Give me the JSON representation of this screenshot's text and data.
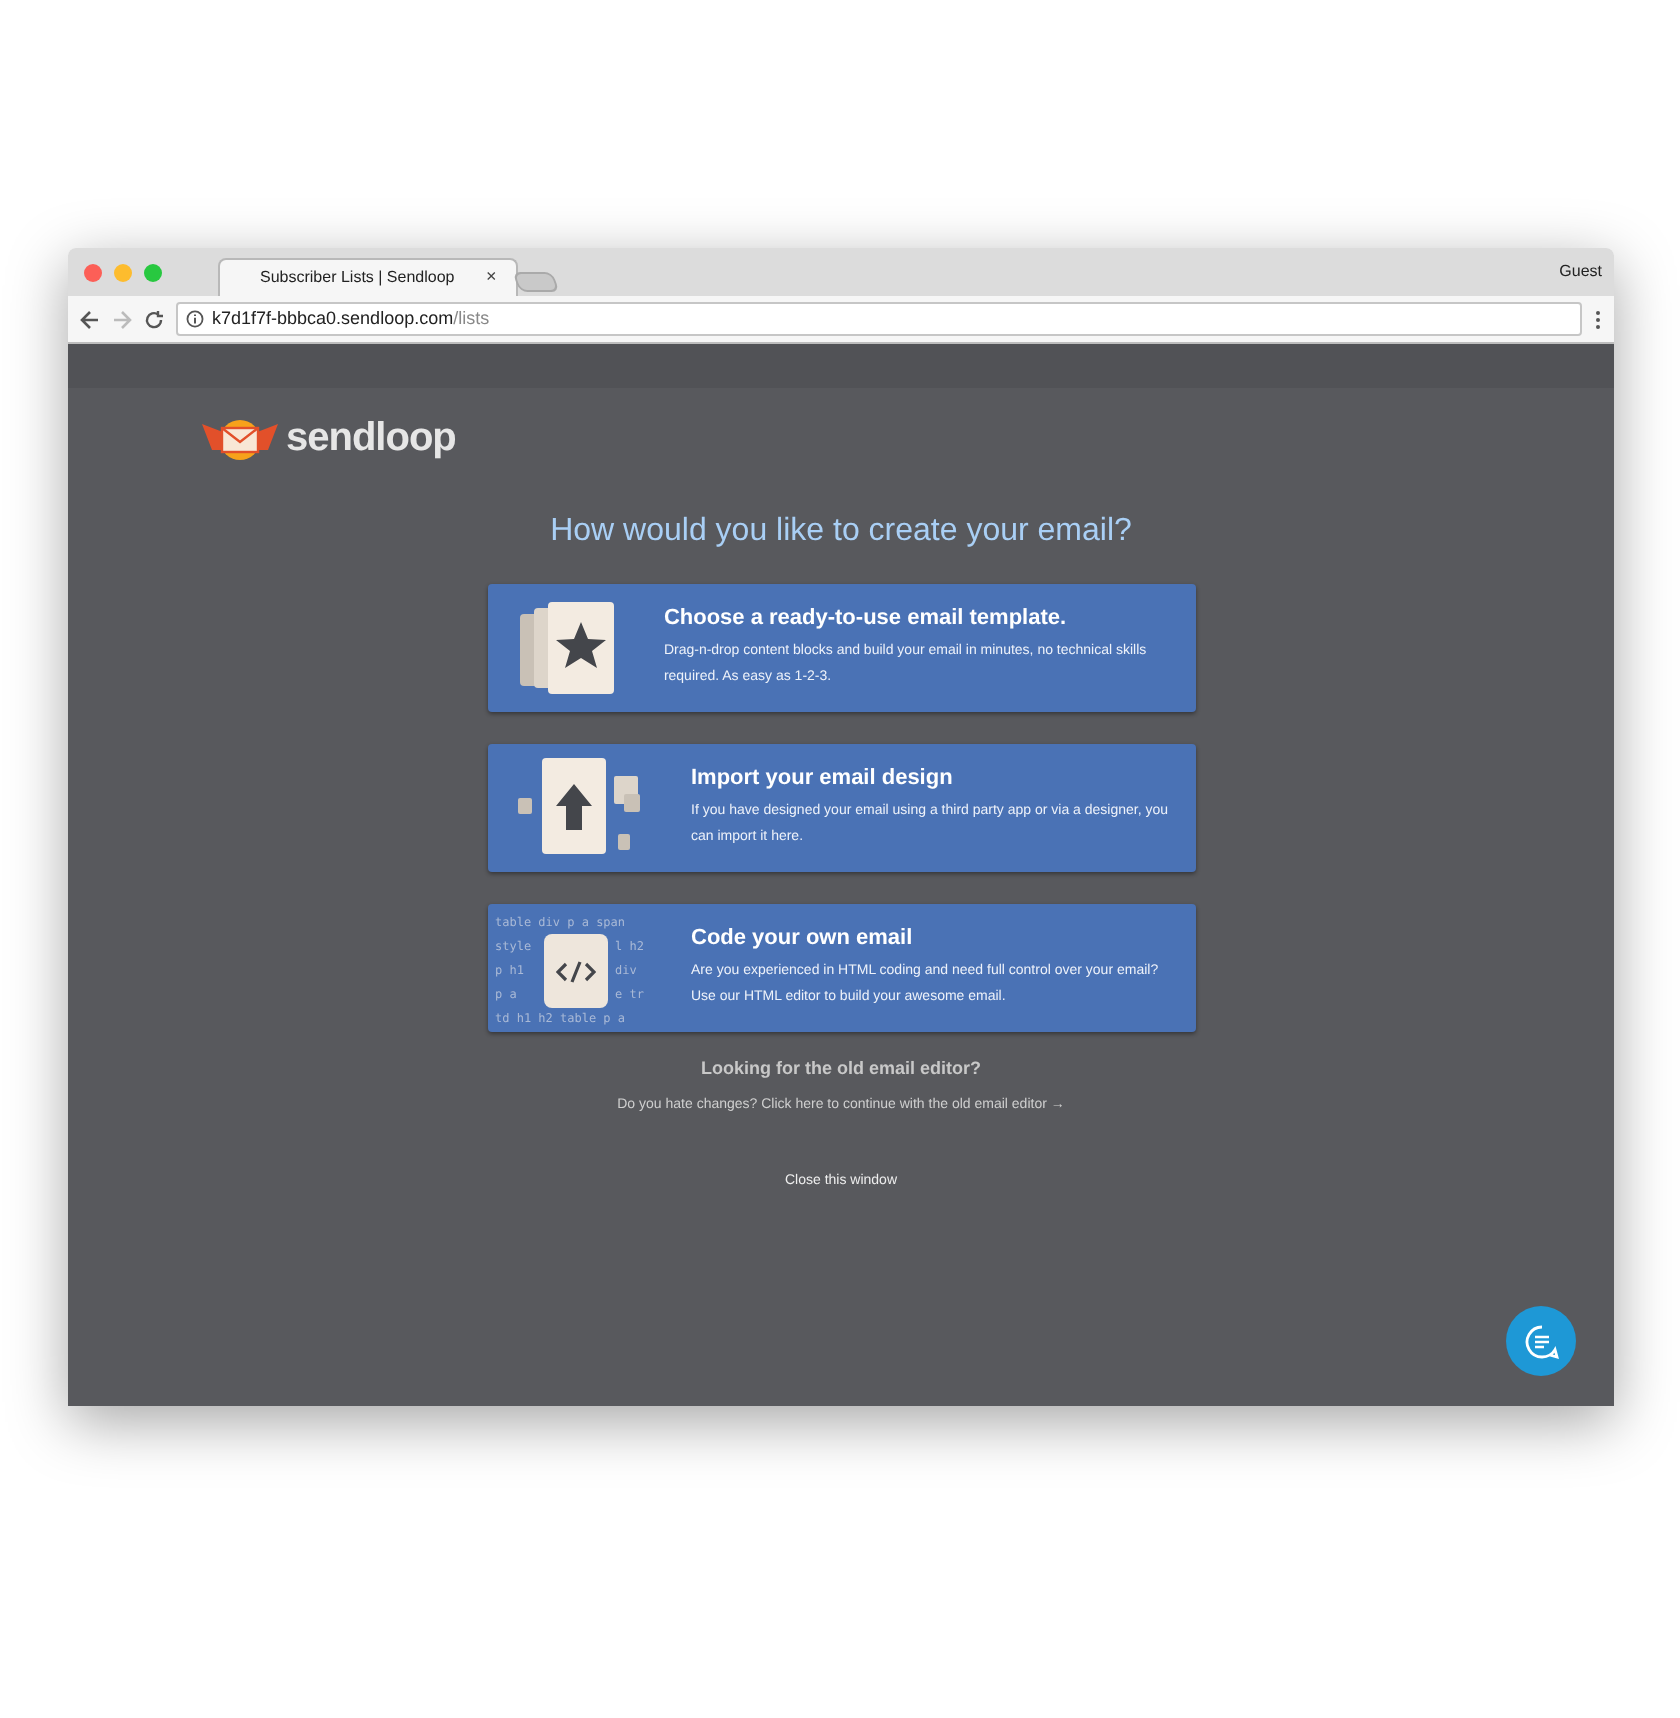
{
  "browser": {
    "tab_title": "Subscriber Lists | Sendloop",
    "tab_close": "×",
    "profile": "Guest",
    "url_host": "k7d1f7f-bbbca0.sendloop.com",
    "url_path": "/lists"
  },
  "brand": {
    "name": "sendloop"
  },
  "heading": "How would you like to create your email?",
  "options": [
    {
      "kind": "template",
      "title": "Choose a ready-to-use email template.",
      "description": "Drag-n-drop content blocks and build your email in minutes, no technical skills required. As easy as 1-2-3."
    },
    {
      "kind": "import",
      "title": "Import your email design",
      "description": "If you have designed your email using a third party app or via a designer, you can import it here."
    },
    {
      "kind": "code",
      "title": "Code your own email",
      "description": "Are you experienced in HTML coding and need full control over your email? Use our HTML editor to build your awesome email.",
      "code_lines": [
        [
          "table div p a span"
        ],
        [
          "style",
          "l h2"
        ],
        [
          "p h1",
          "div"
        ],
        [
          "p a",
          "e tr"
        ],
        [
          "td h1 h2 table p a"
        ]
      ]
    }
  ],
  "old_editor": {
    "title": "Looking for the old email editor?",
    "link": "Do you hate changes? Click here to continue with the old email editor →"
  },
  "close_link": "Close this window"
}
